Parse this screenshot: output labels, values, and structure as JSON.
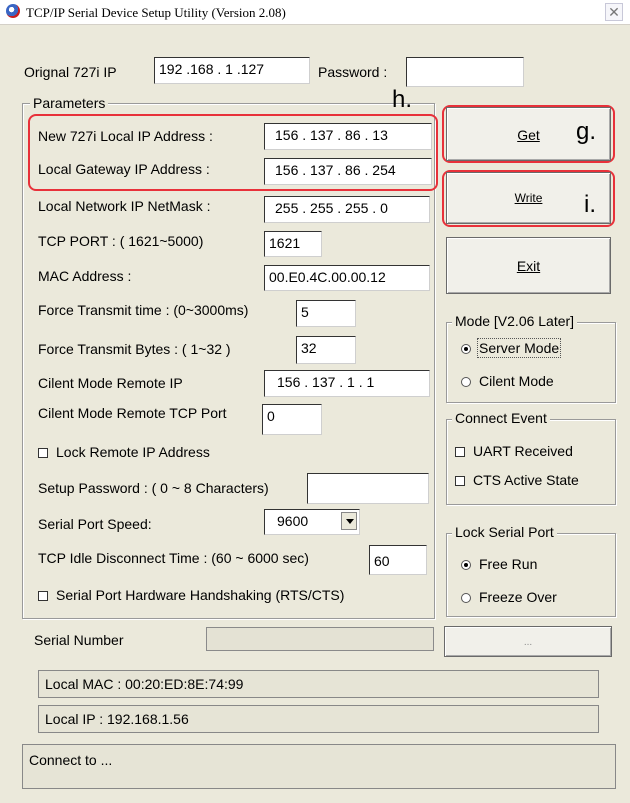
{
  "window": {
    "title": "TCP/IP Serial Device Setup Utility    (Version 2.08)",
    "close_glyph": "✕"
  },
  "login": {
    "ip_label": "Orignal 727i IP",
    "ip_value": "192 .168 .  1  .127",
    "password_label": "Password :",
    "password_value": ""
  },
  "parameters": {
    "legend": "Parameters",
    "local_ip_label": "New 727i Local IP Address :",
    "local_ip_value": "156 . 137 . 86  .  13",
    "gateway_label": "Local Gateway IP  Address :",
    "gateway_value": "156 . 137 . 86  . 254",
    "netmask_label": "Local Network  IP NetMask :",
    "netmask_value": "255 . 255 . 255 .  0",
    "tcp_port_label": "TCP PORT : ( 1621~5000)",
    "tcp_port_value": "1621",
    "mac_label": "MAC Address :",
    "mac_value": "00.E0.4C.00.00.12",
    "force_time_label": "Force Transmit time : (0~3000ms)",
    "force_time_value": "5",
    "force_bytes_label": "Force Transmit Bytes : ( 1~32 )",
    "force_bytes_value": "32",
    "remote_ip_label": "Cilent Mode Remote IP",
    "remote_ip_value": "156 . 137 .  1  .  1",
    "remote_port_label": "Cilent Mode Remote TCP Port",
    "remote_port_value": "0",
    "lock_remote_label": "Lock Remote IP Address",
    "setup_password_label": "Setup Password : ( 0 ~ 8 Characters)",
    "setup_password_value": "",
    "serial_speed_label": "Serial Port Speed:",
    "serial_speed_value": "9600",
    "idle_label": "TCP Idle Disconnect  Time : (60 ~ 6000 sec)",
    "idle_value": "60",
    "handshake_label": "Serial Port Hardware Handshaking (RTS/CTS)"
  },
  "buttons": {
    "get": "Get",
    "write": "Write",
    "exit": "Exit",
    "dots": "..."
  },
  "mode": {
    "legend": "Mode [V2.06  Later]",
    "server": "Server Mode",
    "client": "Cilent Mode",
    "selected": "server"
  },
  "connect_event": {
    "legend": "Connect Event",
    "uart": "UART Received",
    "cts": "CTS Active State"
  },
  "lock_serial": {
    "legend": "Lock Serial Port",
    "free_run": "Free Run",
    "freeze_over": "Freeze Over",
    "selected": "free_run"
  },
  "serial_number": {
    "label": "Serial Number",
    "value": ""
  },
  "status": {
    "local_mac": "Local MAC : 00:20:ED:8E:74:99",
    "local_ip": "Local IP  : 192.168.1.56",
    "connect": "Connect to ..."
  },
  "callouts": {
    "g": "g.",
    "h": "h.",
    "i": "i."
  },
  "colors": {
    "highlight": "#e8313a",
    "window_bg": "#ebe9db"
  }
}
